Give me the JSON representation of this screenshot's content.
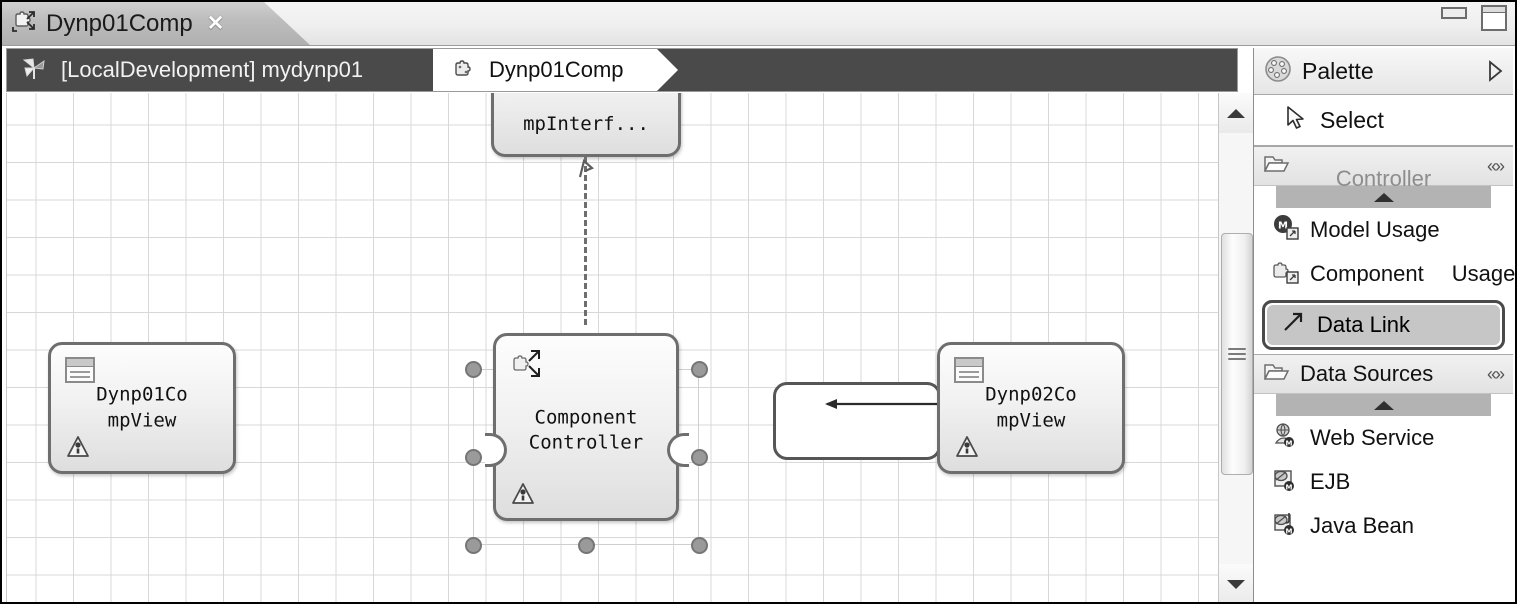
{
  "window": {
    "minimize_label": "minimize",
    "maximize_label": "maximize"
  },
  "tab": {
    "label": "Dynp01Comp",
    "icon": "component-icon",
    "close_glyph": "✕"
  },
  "breadcrumb": {
    "segments": [
      {
        "label": "[LocalDevelopment] mydynp01",
        "icon": "pinwheel-icon"
      },
      {
        "label": "Dynp01Comp",
        "icon": "component-puzzle-icon"
      }
    ]
  },
  "canvas": {
    "nodes": [
      {
        "id": "interface-node",
        "label": "mpInterf...",
        "kind": "interface"
      },
      {
        "id": "dynp01compview",
        "label": "Dynp01Co\nmpView",
        "line1": "Dynp01Co",
        "line2": "mpView",
        "icon": "view-window-icon",
        "badge": "warning-icon"
      },
      {
        "id": "component-controller",
        "label": "Component\nController",
        "line1": "Component",
        "line2": "Controller",
        "icon": "component-arrows-icon",
        "badge": "warning-icon",
        "selected": true
      },
      {
        "id": "dynp02compview",
        "label": "Dynp02Co\nmpView",
        "line1": "Dynp02Co",
        "line2": "mpView",
        "icon": "view-window-icon",
        "badge": "warning-icon"
      }
    ],
    "connections": [
      {
        "from": "component-controller",
        "to": "interface-node",
        "style": "dashed-realization"
      },
      {
        "from": "dynp02compview",
        "to": "data-link-drag",
        "style": "solid-arrow-left"
      }
    ]
  },
  "scrollbar": {
    "up_glyph": "▲",
    "down_glyph": "▼"
  },
  "palette": {
    "title": "Palette",
    "expand_glyph": "▷",
    "select_item": {
      "label": "Select",
      "icon": "cursor-arrow-icon"
    },
    "groups": [
      {
        "title": "",
        "icon": "folder-open-icon",
        "collapse_glyph": "«»",
        "scrolled_label": "Controller",
        "items": [
          {
            "label": "Model Usage",
            "icon": "model-usage-icon",
            "selected": false
          },
          {
            "label": "Component",
            "label2": "Usage",
            "icon": "component-usage-icon",
            "selected": false
          },
          {
            "label": "Data Link",
            "icon": "data-link-arrow-icon",
            "selected": true
          }
        ]
      },
      {
        "title": "Data Sources",
        "icon": "folder-open-icon",
        "collapse_glyph": "«»",
        "items": [
          {
            "label": "Web Service",
            "icon": "web-service-icon",
            "selected": false
          },
          {
            "label": "EJB",
            "icon": "ejb-icon",
            "selected": false
          },
          {
            "label": "Java Bean",
            "icon": "java-bean-icon",
            "selected": false
          }
        ]
      }
    ]
  },
  "colors": {
    "breadcrumb_bg": "#4a4a4a",
    "node_border": "#6e6e6e",
    "selection_handle": "#9a9a9a",
    "palette_selected_bg": "#c6c6c6",
    "grid_line": "#d8d8d8"
  }
}
